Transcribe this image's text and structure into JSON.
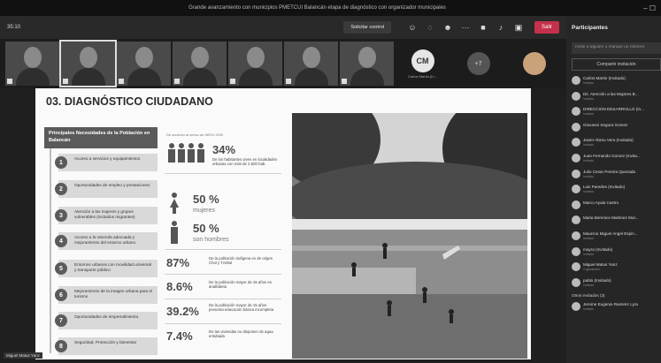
{
  "window": {
    "title": "Grande avanzamiento con municipios PMETCUI Balancán etapa de diagnóstico con organizador municipales"
  },
  "toolbar": {
    "timer": "35:10",
    "request_control": "Solicitar control",
    "leave": "Salir"
  },
  "tiles": [
    {
      "name": "",
      "active": false
    },
    {
      "name": "",
      "active": true
    },
    {
      "name": "",
      "active": false
    },
    {
      "name": "",
      "active": false
    },
    {
      "name": "",
      "active": false
    },
    {
      "name": "",
      "active": false
    },
    {
      "name": "",
      "active": false
    }
  ],
  "avatars": [
    {
      "initials": "CM",
      "name": "Carlos Martin (In..."
    },
    {
      "initials": "+7"
    }
  ],
  "slide": {
    "title": "03. DIAGNÓSTICO CIUDADANO",
    "needs_title": "Principales Necesidades de la Población en Balancán",
    "needs": [
      {
        "num": "1",
        "text": "Acceso a servicios y equipamientos"
      },
      {
        "num": "2",
        "text": "Oportunidades de empleo y prestaciones"
      },
      {
        "num": "3",
        "text": "Atención a las mujeres y grupos vulnerables (incluidos migrantes)"
      },
      {
        "num": "4",
        "text": "Acceso a la vivienda adecuada y mejoramiento del entorno urbano"
      },
      {
        "num": "5",
        "text": "Entornos urbanos con movilidad universal y transporte público"
      },
      {
        "num": "6",
        "text": "Mejoramiento de la imagen urbana para el turismo"
      },
      {
        "num": "7",
        "text": "Oportunidades de emprendimiento"
      },
      {
        "num": "8",
        "text": "Seguridad, Protección y bienestar"
      }
    ],
    "stats_caption": "De acuerdo al censo de INEGI 2020",
    "stats": {
      "urban_pct": "34%",
      "urban_text": "De los habitantes viven en localidades urbanas con más de 2,500 hab.",
      "women_pct": "50 %",
      "women_label": "mujeres",
      "men_pct": "50 %",
      "men_label": "son hombres",
      "indigenous_pct": "87%",
      "indigenous_text": "De la población indígena es de origen Chol y Tzeltal",
      "illiterate_pct": "8.6%",
      "illiterate_text": "De la población mayor de 15 años es analfabeta",
      "education_pct": "39.2%",
      "education_text": "De la población mayor de 15 años presenta educación básica incompleta",
      "water_pct": "7.4%",
      "water_text": "De las viviendas no disponen de agua entubada"
    }
  },
  "presenter_tag": "Miguel Matus Yanz",
  "panel": {
    "title": "Participantes",
    "search": "Invite a alguien o marque un número",
    "share": "Compartir invitación",
    "participants": [
      {
        "name": "Carlos Martin (Invitado)",
        "sub": "Invitado"
      },
      {
        "name": "Dir. Atención a las Mujeres B...",
        "sub": "Invitado"
      },
      {
        "name": "DIRECCION DESARROLLO (In...",
        "sub": "Invitado"
      },
      {
        "name": "Giovanni Segura Gomez",
        "sub": ""
      },
      {
        "name": "Javier Abreu Vera (Invitado)",
        "sub": "Invitado"
      },
      {
        "name": "Juan Fernando Gomez (Invita...",
        "sub": "Invitado"
      },
      {
        "name": "Julio Cesar Pereira Quezada",
        "sub": "Invitado"
      },
      {
        "name": "Luis Paredes (Invitado)",
        "sub": "Invitado"
      },
      {
        "name": "Marco Ayala Castro",
        "sub": ""
      },
      {
        "name": "Maria Berenice Martinez Mut...",
        "sub": ""
      },
      {
        "name": "Mauricio Miguel Angel Espin...",
        "sub": "Invitado"
      },
      {
        "name": "mayra (Invitado)",
        "sub": "Invitado"
      },
      {
        "name": "Miguel Matus Yanz",
        "sub": "Organizador"
      },
      {
        "name": "pablo (Invitado)",
        "sub": "Invitado"
      }
    ],
    "others_label": "Otros invitados (3)",
    "others": [
      {
        "name": "Jerome Eugenio Ramirez Lyra",
        "sub": "Invitado"
      }
    ]
  }
}
